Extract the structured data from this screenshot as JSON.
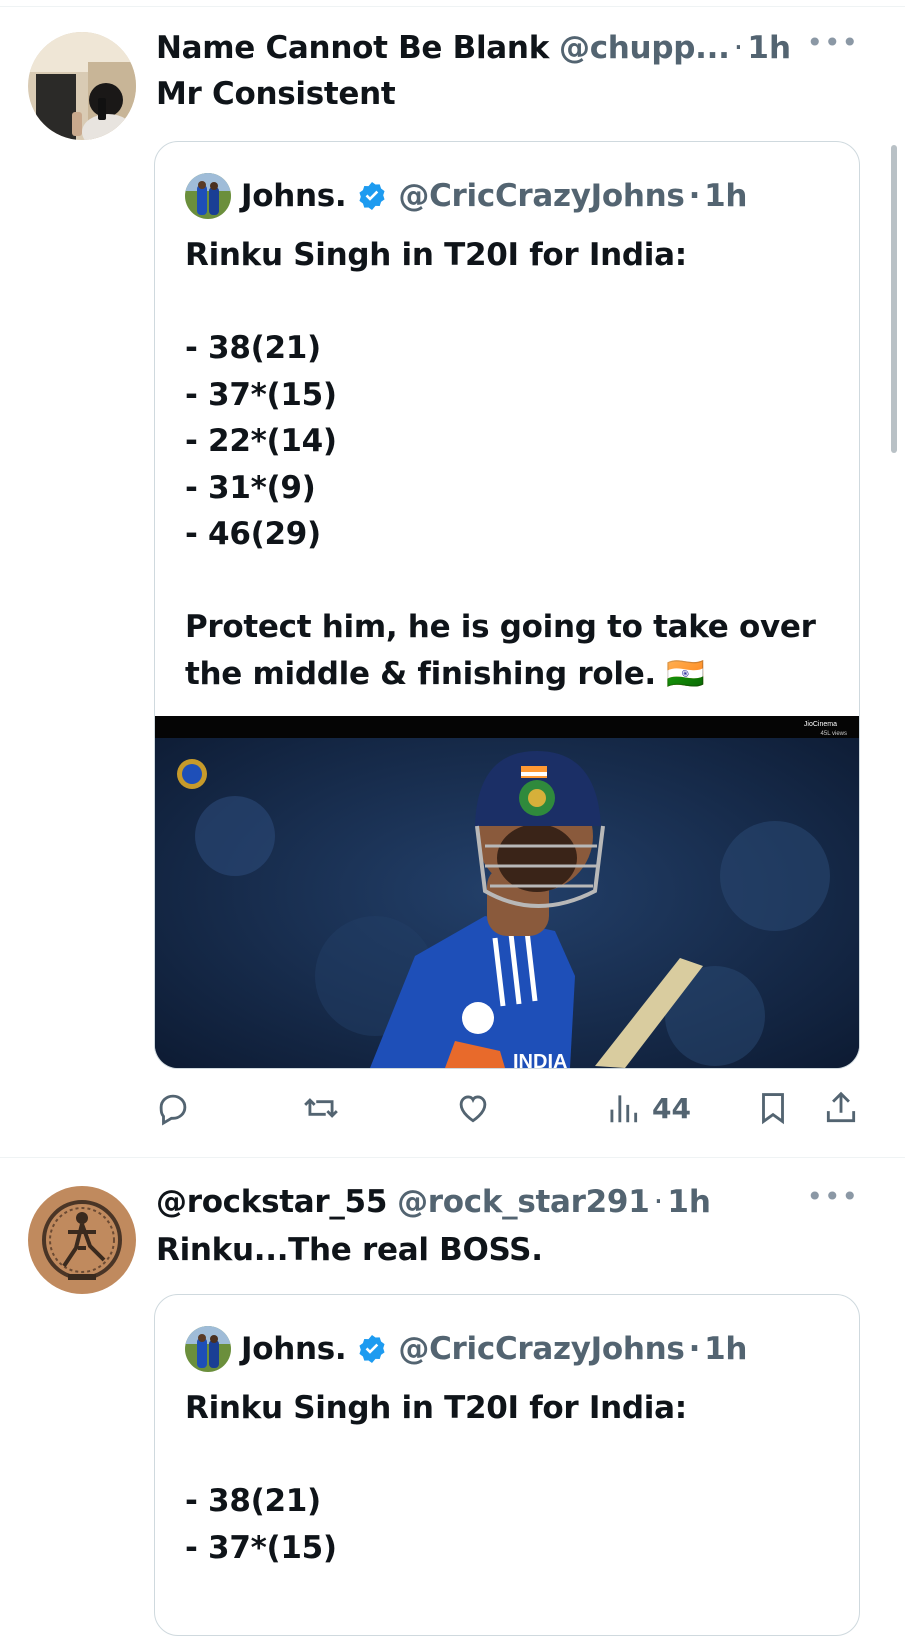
{
  "tweets": [
    {
      "author_name": "Name Cannot Be Blank",
      "author_handle": "@chupp...",
      "separator": "·",
      "time": "1h",
      "text": "Mr Consistent",
      "quote": {
        "name": "Johns.",
        "handle": "@CricCrazyJohns",
        "separator": "·",
        "time": "1h",
        "lines": [
          "Rinku Singh in T20I for India:",
          "",
          "- 38(21)",
          "- 37*(15)",
          "- 22*(14)",
          "- 31*(9)",
          "- 46(29)",
          "",
          "Protect him, he is going to take over",
          "the middle & finishing role. 🇮🇳"
        ],
        "media": {
          "watermark_title": "JioCinema",
          "watermark_views": "45L views",
          "jersey_text": "INDIA"
        }
      },
      "actions": {
        "views": "44"
      }
    },
    {
      "author_name": "@rockstar_55",
      "author_handle": "@rock_star291",
      "separator": "·",
      "time": "1h",
      "text": "Rinku...The real BOSS.",
      "quote": {
        "name": "Johns.",
        "handle": "@CricCrazyJohns",
        "separator": "·",
        "time": "1h",
        "lines": [
          "Rinku Singh in T20I for India:",
          "",
          "- 38(21)",
          "- 37*(15)"
        ]
      }
    }
  ],
  "more_label": "•••",
  "colors": {
    "text_primary": "#0f1419",
    "text_secondary": "#536471",
    "verified": "#1d9bf0",
    "border": "#cfd9de",
    "jersey_blue": "#1e4fb8"
  }
}
